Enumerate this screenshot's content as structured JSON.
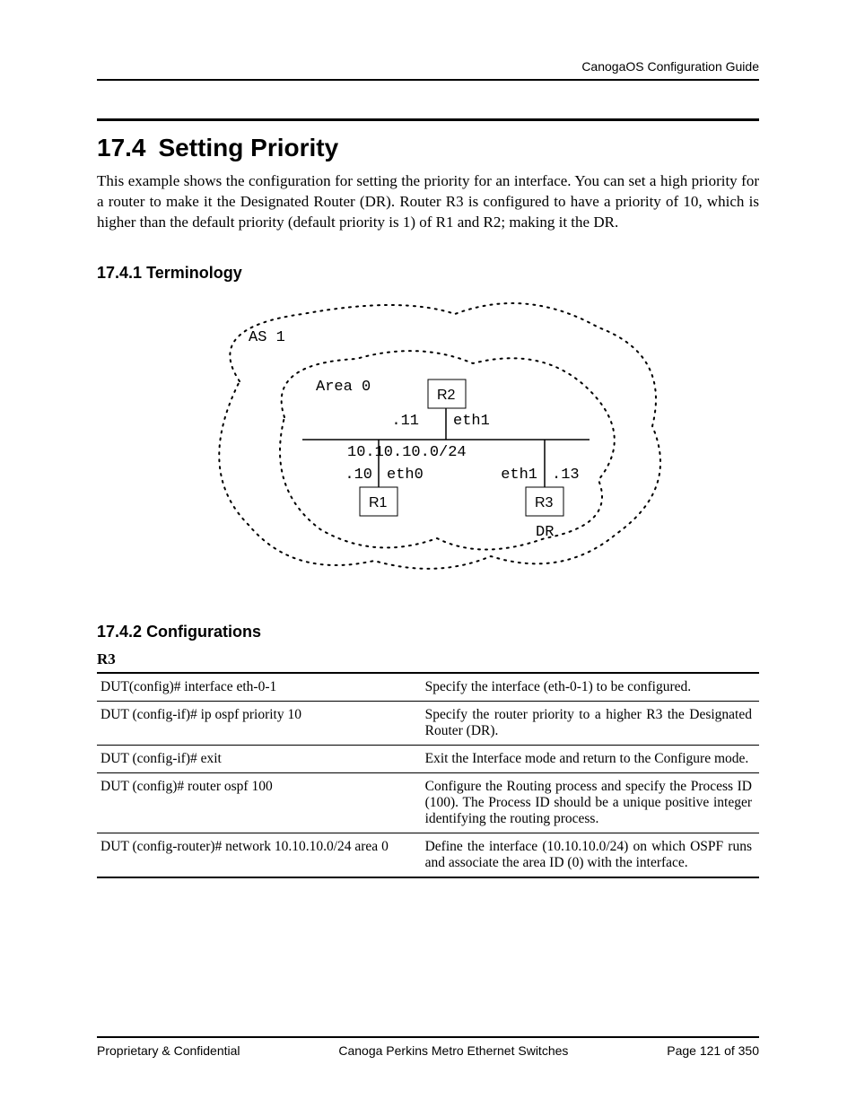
{
  "header": {
    "doc_title": "CanogaOS Configuration Guide"
  },
  "section": {
    "number": "17.4",
    "title": "Setting Priority",
    "intro": "This example shows the configuration for setting the priority for an interface. You can set a high priority for a router to make it the Designated Router (DR). Router R3 is configured to have a priority of 10, which is higher than the default priority (default priority is 1) of R1 and R2; making it the DR."
  },
  "sub1": {
    "number": "17.4.1",
    "title": "Terminology"
  },
  "diagram": {
    "as_label": "AS 1",
    "area_label": "Area 0",
    "subnet": "10.10.10.0/24",
    "r1": {
      "name": "R1",
      "if": "eth0",
      "host": ".10"
    },
    "r2": {
      "name": "R2",
      "if": "eth1",
      "host": ".11"
    },
    "r3": {
      "name": "R3",
      "if": "eth1",
      "host": ".13",
      "role": "DR"
    }
  },
  "sub2": {
    "number": "17.4.2",
    "title": "Configurations"
  },
  "device": "R3",
  "rows": [
    {
      "cmd": "DUT(config)# interface eth-0-1",
      "desc": "Specify the interface (eth-0-1) to be configured."
    },
    {
      "cmd": "DUT (config-if)# ip ospf priority 10",
      "desc": "Specify the router priority to a higher R3 the Designated Router (DR)."
    },
    {
      "cmd": "DUT (config-if)# exit",
      "desc": "Exit the Interface mode and return to the Configure mode."
    },
    {
      "cmd": "DUT (config)# router ospf 100",
      "desc": "Configure the Routing process and specify the Process ID (100). The Process ID should be a unique positive integer identifying the routing process."
    },
    {
      "cmd": "DUT (config-router)# network 10.10.10.0/24 area 0",
      "desc": "Define the interface (10.10.10.0/24) on which OSPF runs and associate the area ID (0) with the interface."
    }
  ],
  "footer": {
    "left": "Proprietary & Confidential",
    "center": "Canoga Perkins Metro Ethernet Switches",
    "right": "Page 121 of 350"
  }
}
